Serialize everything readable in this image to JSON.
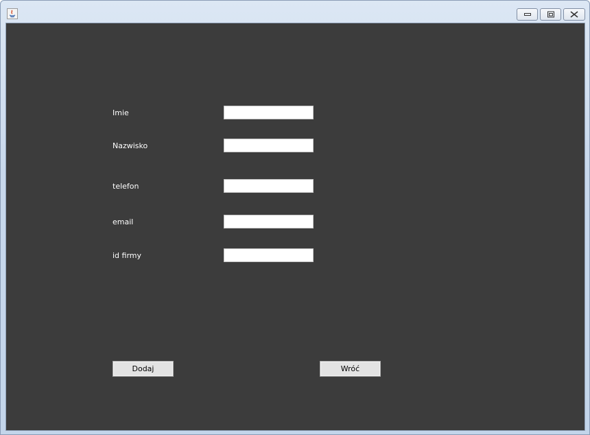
{
  "window": {
    "controls": {
      "minimize_icon": "minimize-icon",
      "maximize_icon": "maximize-icon",
      "close_icon": "close-icon"
    },
    "app_icon": "java-icon"
  },
  "form": {
    "fields": [
      {
        "label": "Imie",
        "value": ""
      },
      {
        "label": "Nazwisko",
        "value": ""
      },
      {
        "label": "telefon",
        "value": ""
      },
      {
        "label": "email",
        "value": ""
      },
      {
        "label": "id firmy",
        "value": ""
      }
    ]
  },
  "actions": {
    "add_label": "Dodaj",
    "back_label": "Wróć"
  },
  "colors": {
    "background": "#3c3c3c",
    "label_text": "#ffffff",
    "field_background": "#ffffff",
    "button_background": "#e3e3e3"
  }
}
